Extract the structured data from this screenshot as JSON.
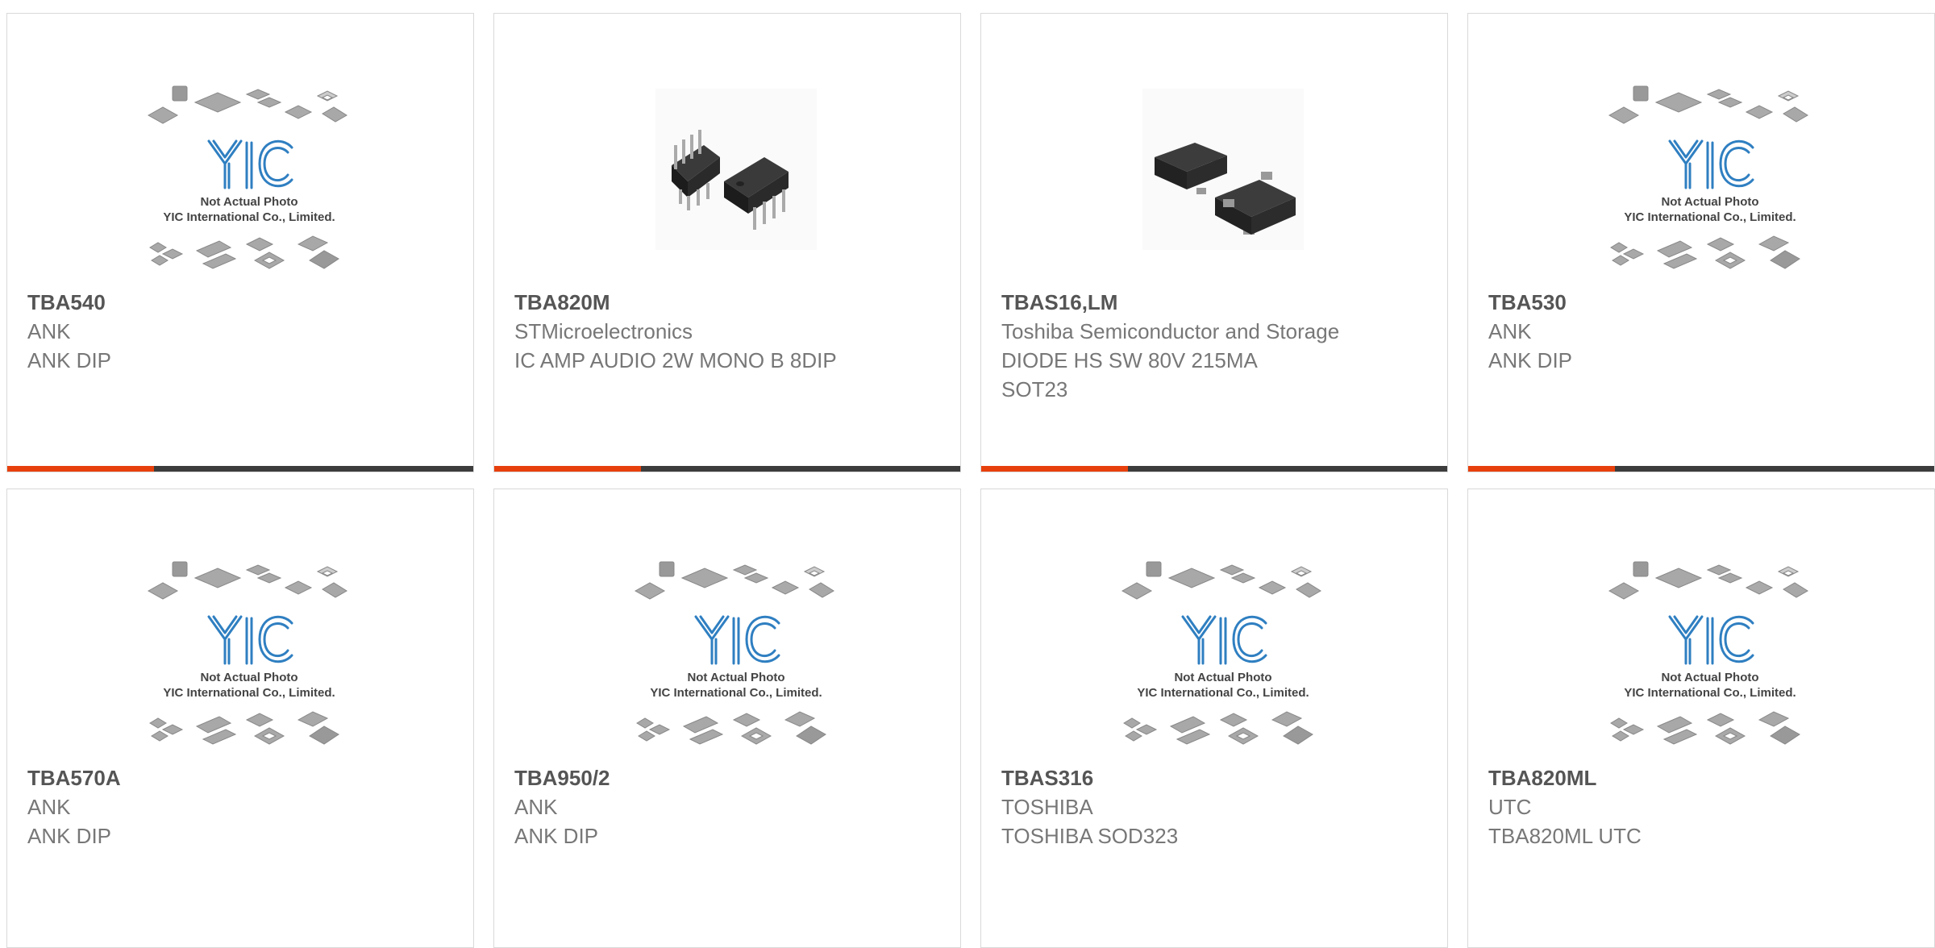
{
  "colors": {
    "accent": "#e8400c",
    "bar_dark": "#3c3c3c",
    "logo_blue": "#2f7fc1",
    "chip_gray": "#a8a8a8"
  },
  "placeholder": {
    "line1": "Not Actual Photo",
    "line2": "YIC International Co., Limited."
  },
  "products": [
    {
      "part": "TBA540",
      "maker": "ANK",
      "desc": "ANK DIP",
      "image": "placeholder"
    },
    {
      "part": "TBA820M",
      "maker": "STMicroelectronics",
      "desc": "IC AMP AUDIO 2W MONO B 8DIP",
      "image": "dip-chips-icon"
    },
    {
      "part": "TBAS16,LM",
      "maker": "Toshiba Semiconductor and Storage",
      "desc": "DIODE HS SW 80V 215MA SOT23",
      "image": "sot23-chips-icon"
    },
    {
      "part": "TBA530",
      "maker": "ANK",
      "desc": "ANK DIP",
      "image": "placeholder"
    },
    {
      "part": "TBA570A",
      "maker": "ANK",
      "desc": "ANK DIP",
      "image": "placeholder"
    },
    {
      "part": "TBA950/2",
      "maker": "ANK",
      "desc": "ANK DIP",
      "image": "placeholder"
    },
    {
      "part": "TBAS316",
      "maker": "TOSHIBA",
      "desc": "TOSHIBA SOD323",
      "image": "placeholder"
    },
    {
      "part": "TBA820ML",
      "maker": "UTC",
      "desc": "TBA820ML UTC",
      "image": "placeholder"
    }
  ]
}
